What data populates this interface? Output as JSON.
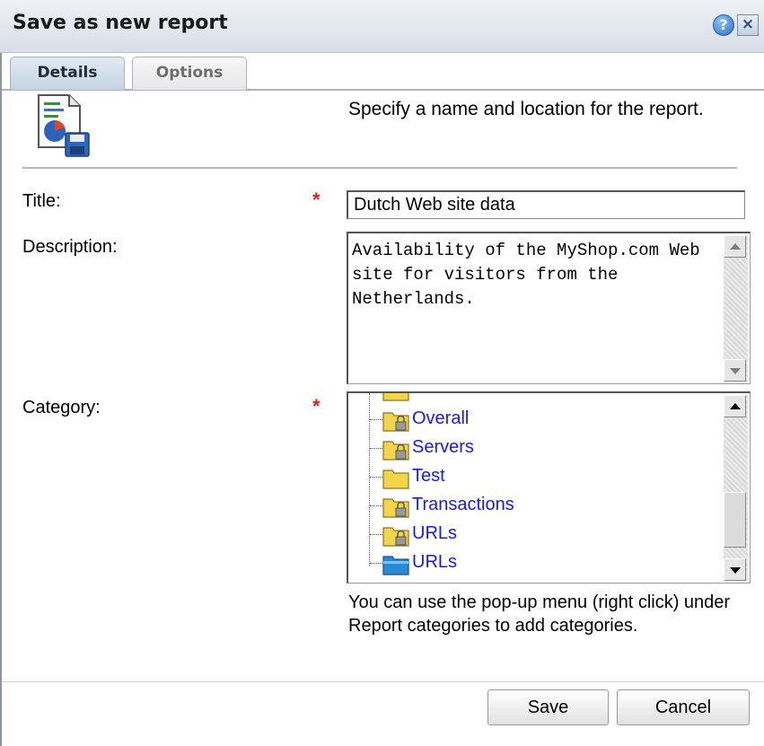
{
  "dialog": {
    "title": "Save as new report",
    "help_glyph": "?",
    "close_glyph": "×"
  },
  "tabs": [
    {
      "label": "Details",
      "active": true
    },
    {
      "label": "Options",
      "active": false
    }
  ],
  "intro_text": "Specify a name and location for the report.",
  "form": {
    "title_label": "Title:",
    "title_value": "Dutch Web site data",
    "description_label": "Description:",
    "description_value": "Availability of the MyShop.com Web site for visitors from the Netherlands.",
    "category_label": "Category:",
    "required_marker": "*"
  },
  "category_tree": [
    {
      "label": "Overall",
      "icon": "locked-folder-icon"
    },
    {
      "label": "Servers",
      "icon": "locked-folder-icon"
    },
    {
      "label": "Test",
      "icon": "folder-icon"
    },
    {
      "label": "Transactions",
      "icon": "locked-folder-icon"
    },
    {
      "label": "URLs",
      "icon": "locked-folder-icon"
    },
    {
      "label": "URLs",
      "icon": "selected-folder-icon"
    }
  ],
  "hint_text": "You can use the pop-up menu (right click) under Report categories to add categories.",
  "buttons": {
    "save": "Save",
    "cancel": "Cancel"
  },
  "colors": {
    "link_blue": "#1a1ae6",
    "required_red": "#e02020",
    "folder_yellow": "#f3d54a",
    "folder_blue": "#2a8ad6"
  }
}
